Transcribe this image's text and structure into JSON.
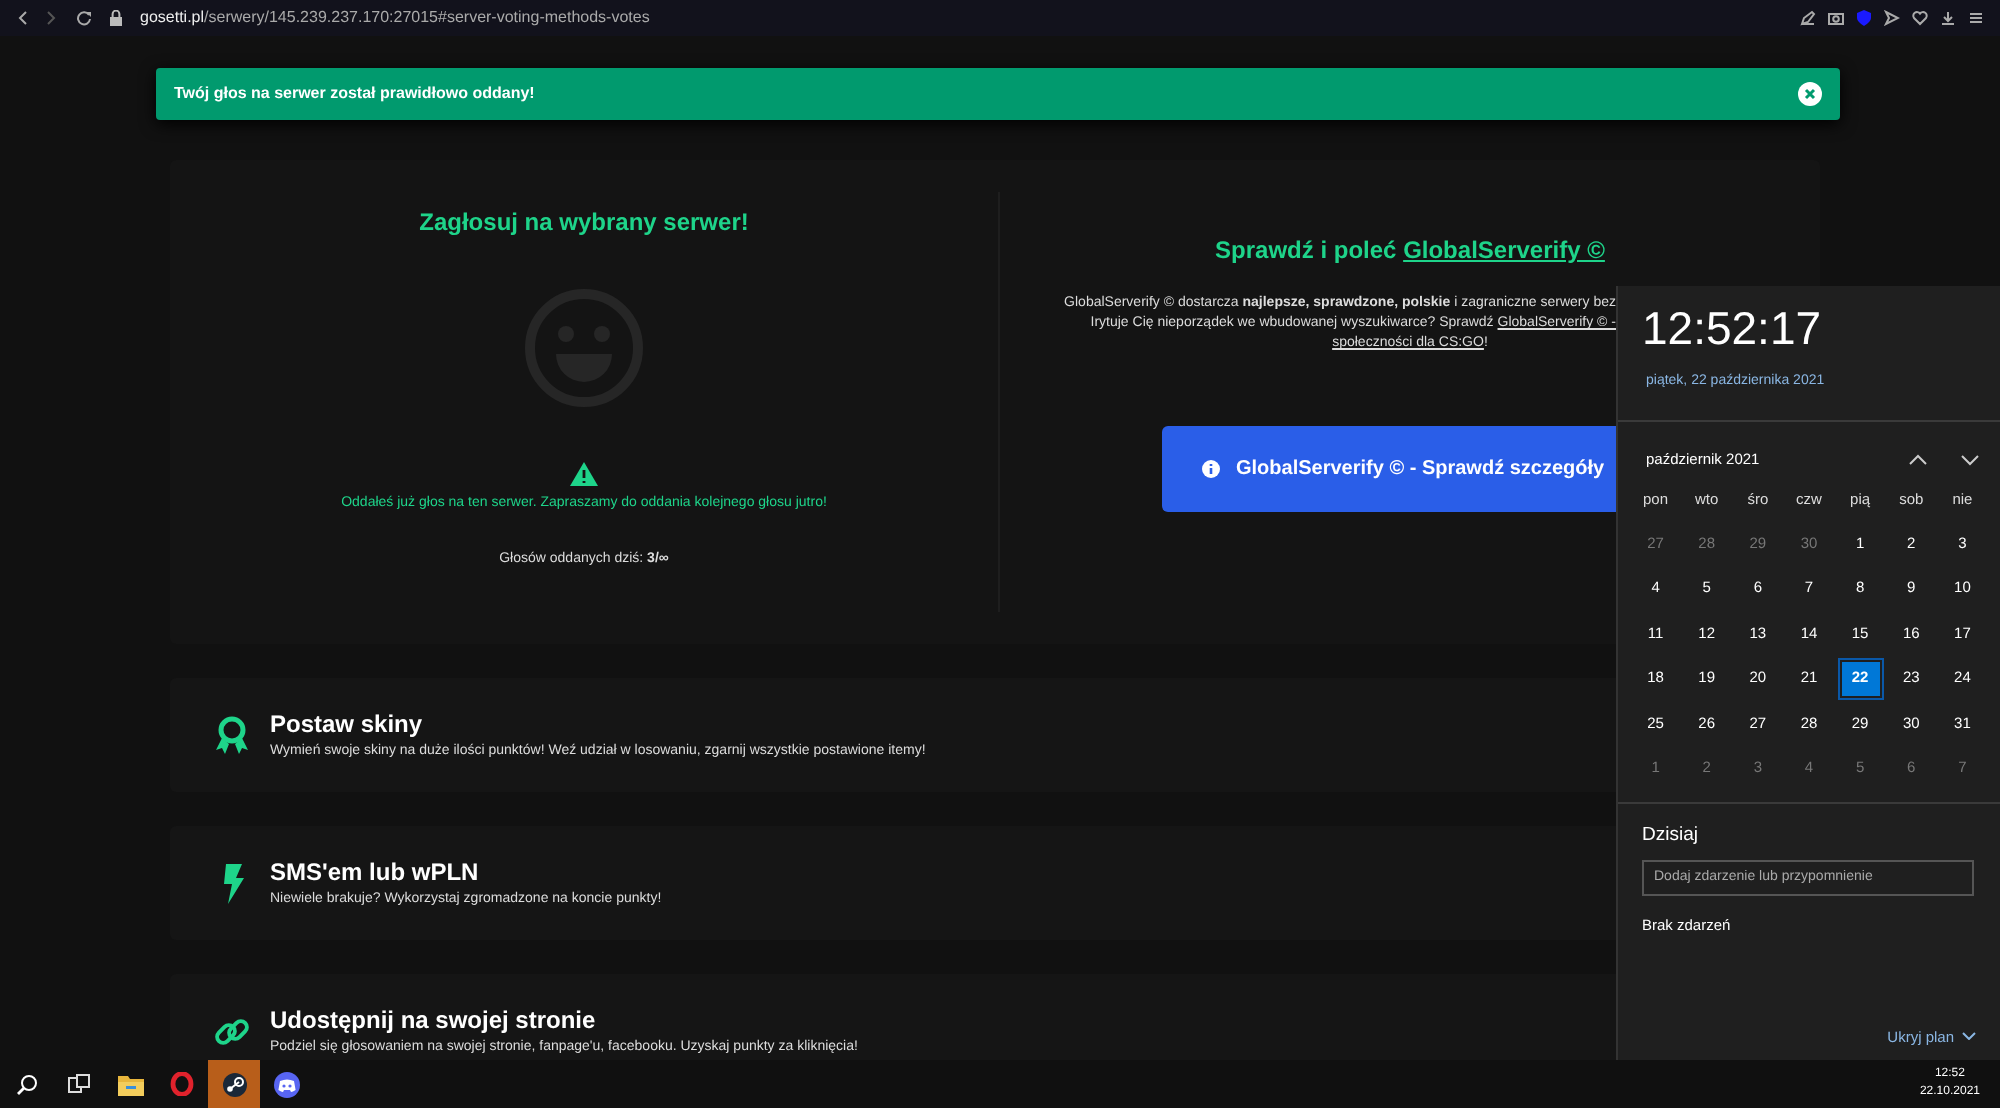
{
  "browser": {
    "url_host": "gosetti.pl",
    "url_path": "/serwery/145.239.237.170:27015#server-voting-methods-votes"
  },
  "alert": {
    "message": "Twój głos na serwer został prawidłowo oddany!"
  },
  "vote": {
    "title": "Zagłosuj na wybrany serwer!",
    "notice": "Oddałeś już głos na ten serwer. Zapraszamy do oddania kolejnego głosu jutro!",
    "count_text": "Głosów oddanych dziś: **3/∞**"
  },
  "promo": {
    "title_prefix": "Sprawdź i poleć",
    "title_link": "GlobalServerify ©",
    "line_1": "GlobalServerify © dostarcza **najlepsze, sprawdzone, polskie** i zagraniczne serwery bez",
    "line_2": "Irytuje Cię nieporządek we wbudowanej wyszukiwarce? Sprawdź",
    "line_2_link": "GlobalServerify © -",
    "line_3_link": "społeczności dla CS:GO",
    "line_3_end": "!",
    "button": "GlobalServerify © - Sprawdź szczegóły"
  },
  "features": [
    {
      "kind": "award",
      "title": "Postaw skiny",
      "text": "Wymień swoje skiny na duże ilości punktów! Weź udział w losowaniu, zgarnij wszystkie postawione itemy!"
    },
    {
      "kind": "bolt",
      "title": "SMS'em lub wPLN",
      "text": "Niewiele brakuje? Wykorzystaj zgromadzone na koncie punkty!"
    },
    {
      "kind": "link",
      "title": "Udostępnij na swojej stronie",
      "text": "Podziel się głosowaniem na swojej stronie, fanpage'u, facebooku. Uzyskaj punkty za kliknięcia!"
    }
  ],
  "calendar": {
    "time": "12:52:17",
    "date": "piątek, 22 października 2021",
    "month": "październik 2021",
    "weekdays": [
      "pon",
      "wto",
      "śro",
      "czw",
      "pią",
      "sob",
      "nie"
    ],
    "weeks": [
      [
        {
          "day": "27",
          "other_month": true,
          "selected": false
        },
        {
          "day": "28",
          "other_month": true,
          "selected": false
        },
        {
          "day": "29",
          "other_month": true,
          "selected": false
        },
        {
          "day": "30",
          "other_month": true,
          "selected": false
        },
        {
          "day": "1",
          "other_month": false,
          "selected": false
        },
        {
          "day": "2",
          "other_month": false,
          "selected": false
        },
        {
          "day": "3",
          "other_month": false,
          "selected": false
        }
      ],
      [
        {
          "day": "4",
          "other_month": false,
          "selected": false
        },
        {
          "day": "5",
          "other_month": false,
          "selected": false
        },
        {
          "day": "6",
          "other_month": false,
          "selected": false
        },
        {
          "day": "7",
          "other_month": false,
          "selected": false
        },
        {
          "day": "8",
          "other_month": false,
          "selected": false
        },
        {
          "day": "9",
          "other_month": false,
          "selected": false
        },
        {
          "day": "10",
          "other_month": false,
          "selected": false
        }
      ],
      [
        {
          "day": "11",
          "other_month": false,
          "selected": false
        },
        {
          "day": "12",
          "other_month": false,
          "selected": false
        },
        {
          "day": "13",
          "other_month": false,
          "selected": false
        },
        {
          "day": "14",
          "other_month": false,
          "selected": false
        },
        {
          "day": "15",
          "other_month": false,
          "selected": false
        },
        {
          "day": "16",
          "other_month": false,
          "selected": false
        },
        {
          "day": "17",
          "other_month": false,
          "selected": false
        }
      ],
      [
        {
          "day": "18",
          "other_month": false,
          "selected": false
        },
        {
          "day": "19",
          "other_month": false,
          "selected": false
        },
        {
          "day": "20",
          "other_month": false,
          "selected": false
        },
        {
          "day": "21",
          "other_month": false,
          "selected": false
        },
        {
          "day": "22",
          "other_month": false,
          "selected": true
        },
        {
          "day": "23",
          "other_month": false,
          "selected": false
        },
        {
          "day": "24",
          "other_month": false,
          "selected": false
        }
      ],
      [
        {
          "day": "25",
          "other_month": false,
          "selected": false
        },
        {
          "day": "26",
          "other_month": false,
          "selected": false
        },
        {
          "day": "27",
          "other_month": false,
          "selected": false
        },
        {
          "day": "28",
          "other_month": false,
          "selected": false
        },
        {
          "day": "29",
          "other_month": false,
          "selected": false
        },
        {
          "day": "30",
          "other_month": false,
          "selected": false
        },
        {
          "day": "31",
          "other_month": false,
          "selected": false
        }
      ],
      [
        {
          "day": "1",
          "other_month": true,
          "selected": false
        },
        {
          "day": "2",
          "other_month": true,
          "selected": false
        },
        {
          "day": "3",
          "other_month": true,
          "selected": false
        },
        {
          "day": "4",
          "other_month": true,
          "selected": false
        },
        {
          "day": "5",
          "other_month": true,
          "selected": false
        },
        {
          "day": "6",
          "other_month": true,
          "selected": false
        },
        {
          "day": "7",
          "other_month": true,
          "selected": false
        }
      ]
    ],
    "today_label": "Dzisiaj",
    "event_placeholder": "Dodaj zdarzenie lub przypomnienie",
    "no_events": "Brak zdarzeń",
    "hide_plan": "Ukryj plan"
  },
  "taskbar": {
    "apps": [
      {
        "kind": "search",
        "active": false
      },
      {
        "kind": "taskview",
        "active": false
      },
      {
        "kind": "folder",
        "active": false
      },
      {
        "kind": "ring",
        "active": false
      },
      {
        "kind": "piston",
        "active": true
      },
      {
        "kind": "gamepad",
        "active": false
      }
    ],
    "time": "12:52",
    "date": "22.10.2021"
  }
}
